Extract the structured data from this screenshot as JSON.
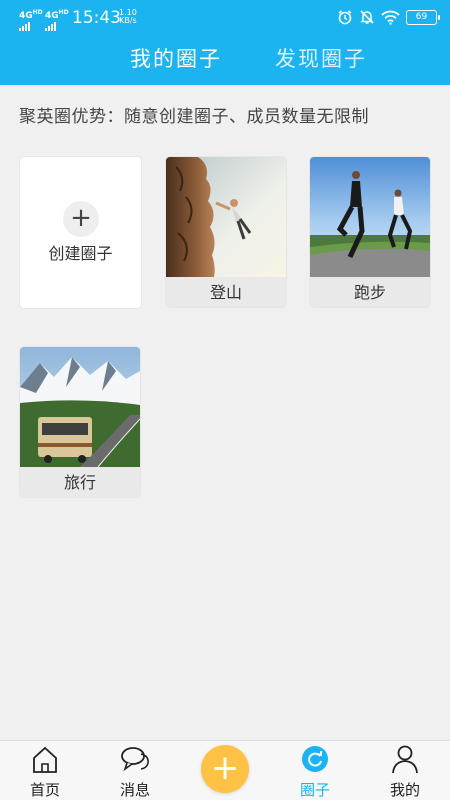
{
  "status_bar": {
    "network_1": "4G",
    "network_1_sup": "HD",
    "network_2": "4G",
    "network_2_sup": "HD",
    "time": "15:43",
    "net_speed_value": "1.10",
    "net_speed_unit": "KB/s",
    "battery": "69",
    "icons": [
      "alarm-icon",
      "mute-icon",
      "wifi-icon",
      "battery-icon"
    ]
  },
  "header": {
    "tabs": [
      {
        "label": "我的圈子",
        "active": true
      },
      {
        "label": "发现圈子",
        "active": false
      }
    ]
  },
  "banner": "聚英圈优势：随意创建圈子、成员数量无限制",
  "create_card": {
    "label": "创建圈子",
    "icon": "plus-icon"
  },
  "circles": [
    {
      "label": "登山",
      "photo": "rock-climber-photo"
    },
    {
      "label": "跑步",
      "photo": "runners-photo"
    },
    {
      "label": "旅行",
      "photo": "motorhome-road-photo"
    }
  ],
  "bottom_nav": {
    "items": [
      {
        "label": "首页",
        "icon": "home-icon"
      },
      {
        "label": "消息",
        "icon": "chat-bubbles-icon"
      },
      {
        "label": "圈子",
        "icon": "circle-refresh-icon",
        "active": true
      },
      {
        "label": "我的",
        "icon": "person-icon"
      }
    ],
    "fab_icon": "plus-icon"
  },
  "colors": {
    "primary": "#1bb4f0",
    "fab": "#ffc245",
    "background": "#f0f0f0",
    "caption_bg": "#e9e9e9"
  }
}
